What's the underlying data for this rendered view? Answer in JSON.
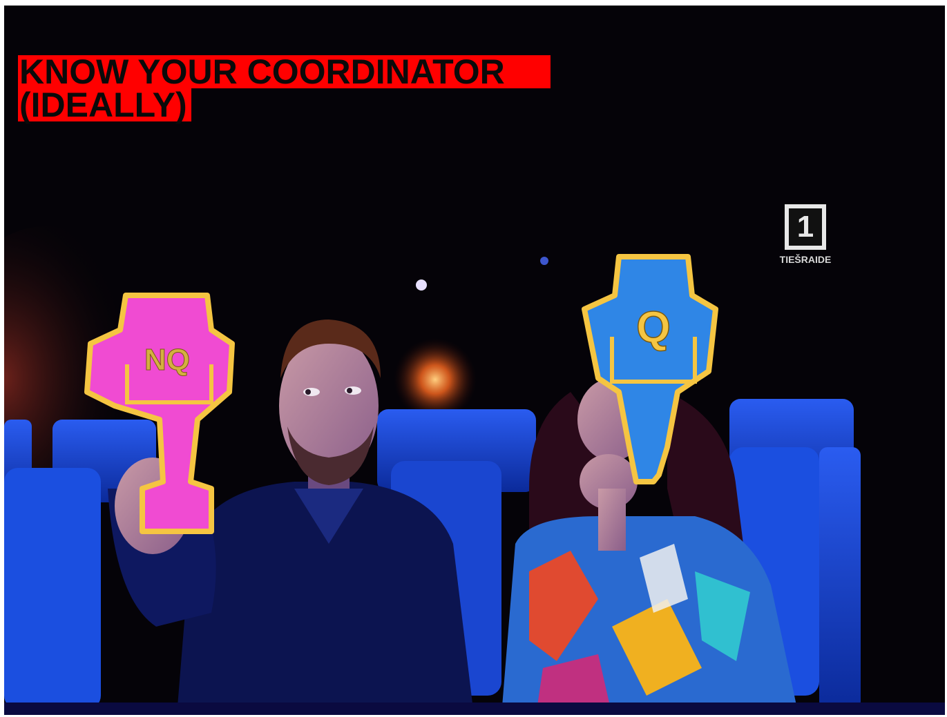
{
  "caption": {
    "line1": "KNOW YOUR COORDINATOR",
    "line2": "(IDEALLY)"
  },
  "broadcaster_logo": {
    "numeral": "1",
    "text": "TIEŠRAIDE"
  },
  "paddles": {
    "left_label": "NQ",
    "right_label": "Q"
  },
  "colors": {
    "caption_background": "#ff0000",
    "caption_text": "#0a0a0a",
    "paddle_pink": "#f04bd2",
    "paddle_blue": "#2f86e6",
    "paddle_outline": "#f5c542",
    "seat_blue": "#1848c8"
  }
}
